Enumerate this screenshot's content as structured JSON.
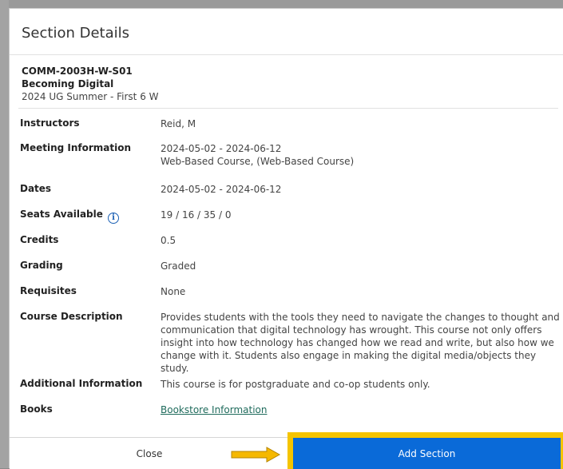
{
  "dialog": {
    "title": "Section Details",
    "course_code": "COMM-2003H-W-S01",
    "course_title": "Becoming Digital",
    "term": "2024 UG Summer - First 6 W"
  },
  "details": {
    "instructors": {
      "label": "Instructors",
      "value": "Reid, M"
    },
    "meeting": {
      "label": "Meeting Information",
      "line1": "2024-05-02 - 2024-06-12",
      "line2": "Web-Based Course, (Web-Based Course)"
    },
    "dates": {
      "label": "Dates",
      "value": "2024-05-02 - 2024-06-12"
    },
    "seats": {
      "label": "Seats Available",
      "value": "19 / 16 / 35 / 0",
      "icon": "info-icon"
    },
    "credits": {
      "label": "Credits",
      "value": "0.5"
    },
    "grading": {
      "label": "Grading",
      "value": "Graded"
    },
    "requisites": {
      "label": "Requisites",
      "value": "None"
    },
    "description": {
      "label": "Course Description",
      "value": "Provides students with the tools they need to navigate the changes to thought and communication that digital technology has wrought. This course not only offers insight into how technology has changed how we read and write, but also how we change with it. Students also engage in making the digital media/objects they study."
    },
    "additional": {
      "label": "Additional Information",
      "value": "This course is for postgraduate and co-op students only."
    },
    "books": {
      "label": "Books",
      "link": "Bookstore Information"
    }
  },
  "footer": {
    "close_label": "Close",
    "add_label": "Add Section"
  },
  "colors": {
    "accent_blue": "#0a6ad8",
    "highlight_yellow": "#f5c400",
    "link_green": "#1f6b5c"
  }
}
